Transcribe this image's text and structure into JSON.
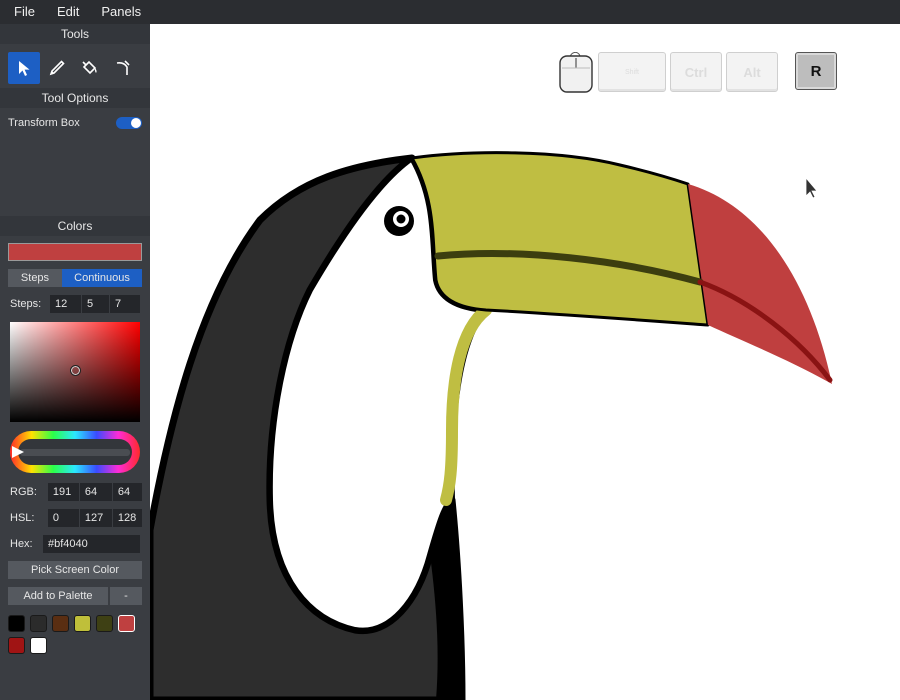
{
  "menu": [
    "File",
    "Edit",
    "Panels"
  ],
  "panels": {
    "tools_title": "Tools",
    "tool_options_title": "Tool Options",
    "colors_title": "Colors"
  },
  "tools": [
    {
      "name": "select-arrow-icon",
      "active": true
    },
    {
      "name": "pencil-icon",
      "active": false
    },
    {
      "name": "paint-bucket-icon",
      "active": false
    },
    {
      "name": "eyedropper-icon",
      "active": false
    }
  ],
  "tool_options": {
    "transform_box_label": "Transform Box",
    "transform_box_on": true
  },
  "colors": {
    "current_color": "#bf4040",
    "mode_steps": "Steps",
    "mode_continuous": "Continuous",
    "active_mode": "Continuous",
    "steps_label": "Steps:",
    "steps": [
      "12",
      "5",
      "7"
    ],
    "rgb_label": "RGB:",
    "rgb": [
      "191",
      "64",
      "64"
    ],
    "hsl_label": "HSL:",
    "hsl": [
      "0",
      "127",
      "128"
    ],
    "hex_label": "Hex:",
    "hex": "#bf4040",
    "pick_screen_color": "Pick Screen Color",
    "add_to_palette": "Add to Palette",
    "remove_from_palette": "-",
    "palette": [
      "#000000",
      "#2b2b2b",
      "#5a2e12",
      "#bfbf3a",
      "#3e4014",
      "#bf4040",
      "#a01414",
      "#ffffff"
    ],
    "selected_palette_index": 5
  },
  "key_overlay": {
    "keys": [
      {
        "label": "Shift",
        "active": false
      },
      {
        "label": "Ctrl",
        "active": false
      },
      {
        "label": "Alt",
        "active": false
      },
      {
        "label": "R",
        "active": true
      }
    ]
  },
  "drawing_colors": {
    "black": "#000000",
    "dark_body": "#2d2d2d",
    "beak_yellow": "#bfbe42",
    "beak_red": "#bf3f3f",
    "beak_line": "#3c3e0f",
    "red_line": "#8a1313"
  }
}
